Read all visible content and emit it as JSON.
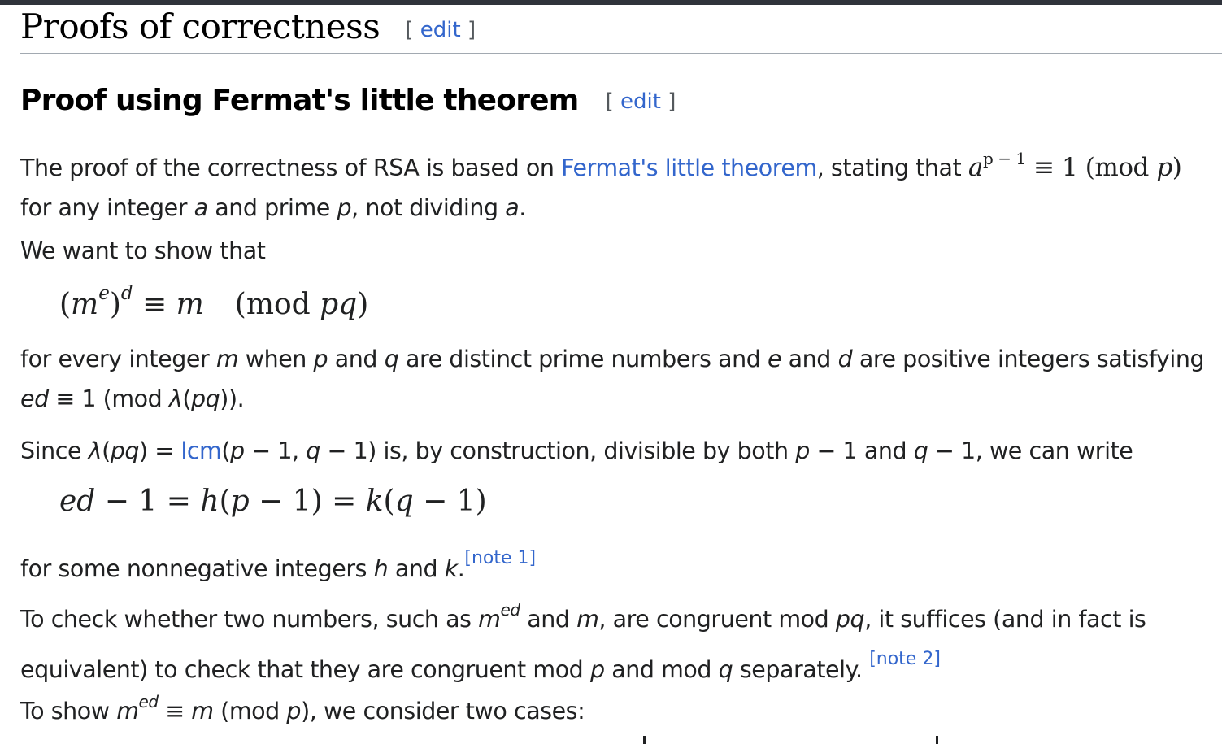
{
  "section": {
    "title": "Proofs of correctness",
    "edit_open": "[",
    "edit_label": "edit",
    "edit_close": "]"
  },
  "subsection": {
    "title": "Proof using Fermat's little theorem",
    "edit_open": "[",
    "edit_label": "edit",
    "edit_close": "]"
  },
  "para1": {
    "line1_a": "The proof of the correctness of RSA is based on ",
    "link_fermat": "Fermat's little theorem",
    "line1_b": ", stating that ",
    "math_base": "a",
    "math_exp": "p − 1",
    "math_rest": " ≡ 1 (mod ",
    "math_p": "p",
    "math_close": ")",
    "line2_a": "for any integer ",
    "var_a": "a",
    "line2_b": " and prime ",
    "var_p": "p",
    "line2_c": ", not dividing ",
    "var_a2": "a",
    "line2_d": "."
  },
  "para2": {
    "text": "We want to show that"
  },
  "formula1": {
    "open": "(",
    "m": "m",
    "e": "e",
    "close": ")",
    "d": "d",
    "equiv": " ≡ ",
    "m2": "m",
    "mod": "(mod  ",
    "pq": "pq",
    "rparen": ")"
  },
  "para3": {
    "a": "for every integer ",
    "m": "m",
    "b": " when ",
    "p": "p",
    "c": " and ",
    "q": "q",
    "d": " are distinct prime numbers and ",
    "e": "e",
    "f": " and ",
    "dvar": "d",
    "g": " are positive integers satisfying",
    "line2_ed": "ed",
    "line2_a": " ≡ 1 (mod ",
    "line2_lambda": "λ",
    "line2_b": "(",
    "line2_pq": "pq",
    "line2_c": "))."
  },
  "para4": {
    "a": "Since ",
    "lambda": "λ",
    "b": "(",
    "pq": "pq",
    "c": ") = ",
    "link_lcm": "lcm",
    "d": "(",
    "p": "p",
    "e": " − 1, ",
    "q": "q",
    "f": " − 1) is, by construction, divisible by both ",
    "p2": "p",
    "g": " − 1 and ",
    "q2": "q",
    "h": " − 1, we can write"
  },
  "formula2": {
    "ed": "ed",
    "a": " − 1 = ",
    "h": "h",
    "b": "(",
    "p": "p",
    "c": " − 1) = ",
    "k": "k",
    "d": "(",
    "q": "q",
    "e": " − 1)"
  },
  "para5": {
    "a": "for some nonnegative integers ",
    "h": "h",
    "b": " and ",
    "k": "k",
    "c": ".",
    "ref": "[note 1]"
  },
  "para6": {
    "a": "To check whether two numbers, such as ",
    "m": "m",
    "ed": "ed",
    "b": " and ",
    "m2": "m",
    "c": ", are congruent mod ",
    "pq": "pq",
    "d": ", it suffices (and in fact is",
    "line2_a": "equivalent) to check that they are congruent mod ",
    "p": "p",
    "line2_b": " and mod ",
    "q": "q",
    "line2_c": " separately.",
    "ref": "[note 2]"
  },
  "para7": {
    "a": "To show ",
    "m": "m",
    "ed": "ed",
    "b": " ≡ ",
    "m2": "m",
    "c": " (mod ",
    "p": "p",
    "d": "), we consider two cases:"
  }
}
